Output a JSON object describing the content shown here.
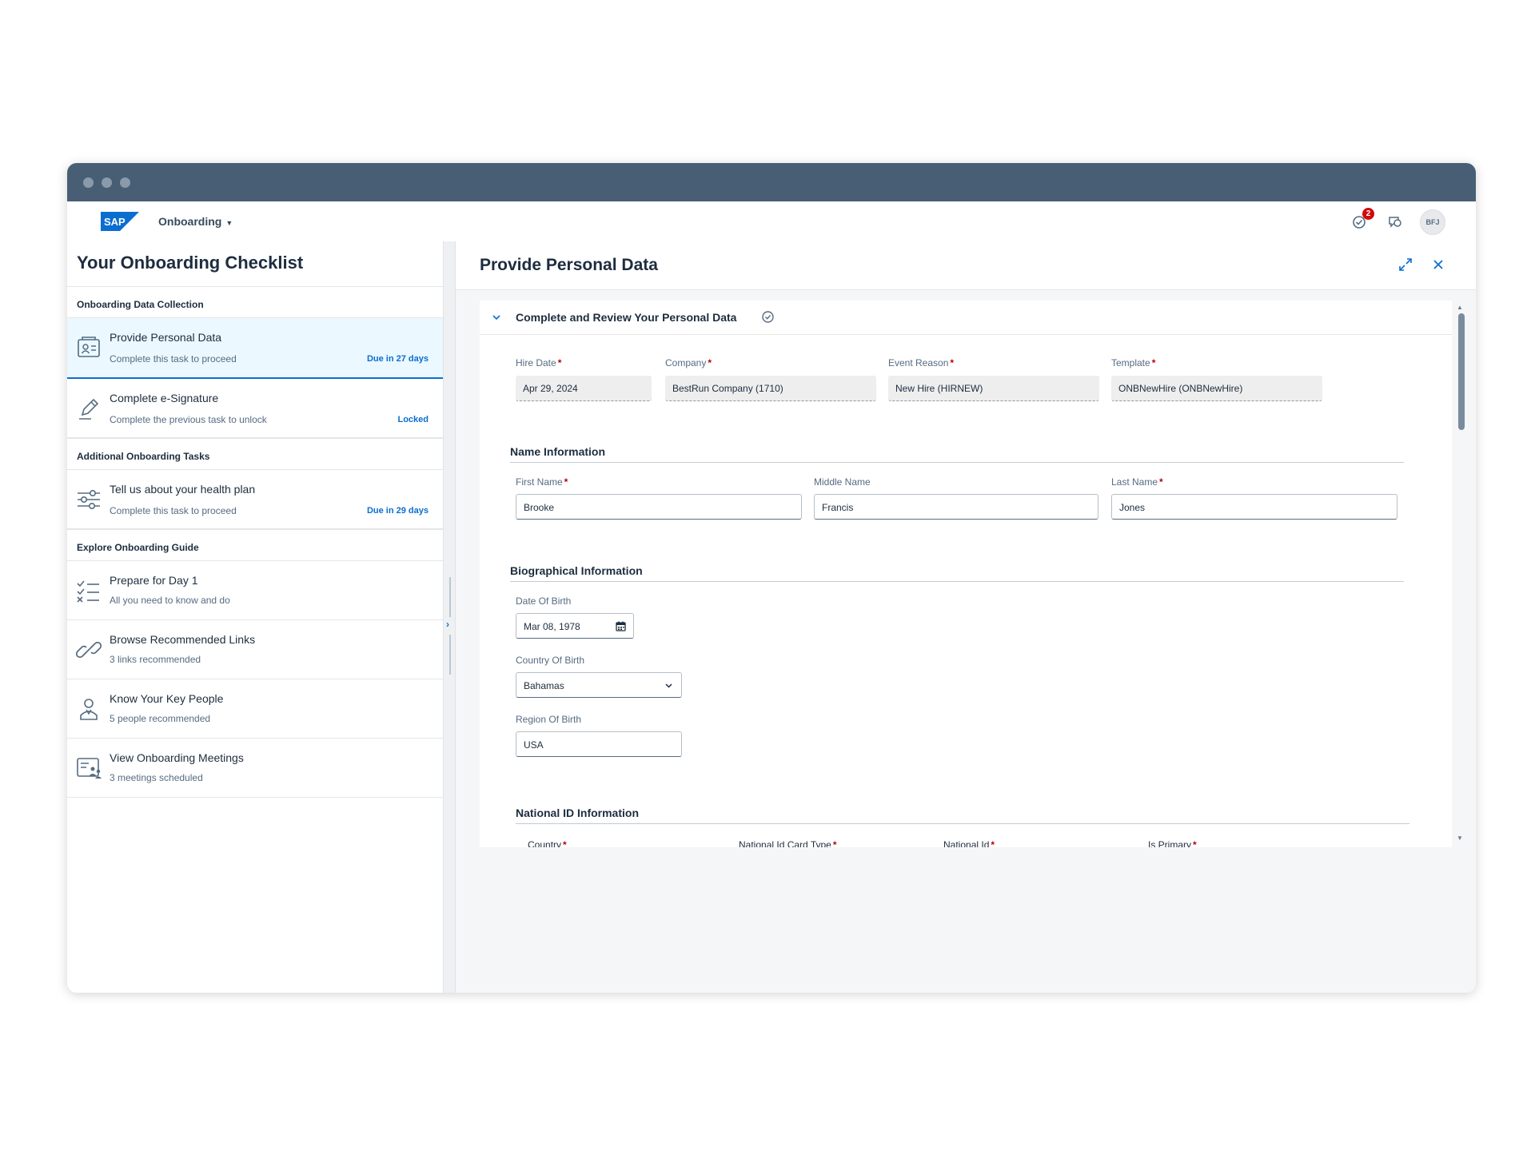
{
  "shellbar": {
    "app_title": "Onboarding",
    "notification_count": "2",
    "avatar_initials": "BFJ",
    "colors": {
      "brand": "#0a6ed1",
      "titlebar": "#475e75",
      "badge": "#d20a0a"
    }
  },
  "checklist": {
    "title": "Your Onboarding Checklist",
    "groups": [
      {
        "header": "Onboarding Data Collection",
        "items": [
          {
            "icon": "id-card-icon",
            "title": "Provide Personal Data",
            "subtitle": "Complete this task to proceed",
            "status": "Due in 27 days"
          },
          {
            "icon": "pen-icon",
            "title": "Complete e-Signature",
            "subtitle": "Complete the previous task to unlock",
            "status": "Locked"
          }
        ]
      },
      {
        "header": "Additional Onboarding Tasks",
        "items": [
          {
            "icon": "sliders-icon",
            "title": "Tell us about your health plan",
            "subtitle": "Complete this task to proceed",
            "status": "Due in 29 days"
          }
        ]
      },
      {
        "header": "Explore Onboarding Guide",
        "items": [
          {
            "icon": "checklist-icon",
            "title": "Prepare for Day 1",
            "subtitle": "All you need to know and do"
          },
          {
            "icon": "link-icon",
            "title": "Browse Recommended Links",
            "subtitle": "3 links recommended"
          },
          {
            "icon": "person-icon",
            "title": "Know Your Key People",
            "subtitle": "5 people recommended"
          },
          {
            "icon": "meeting-icon",
            "title": "View Onboarding Meetings",
            "subtitle": "3 meetings scheduled"
          }
        ]
      }
    ]
  },
  "detail": {
    "title": "Provide Personal Data",
    "section_title": "Complete and Review Your Personal Data",
    "job_info": {
      "hire_date": {
        "label": "Hire Date",
        "value": "Apr 29, 2024"
      },
      "company": {
        "label": "Company",
        "value": "BestRun Company (1710)"
      },
      "event_reason": {
        "label": "Event Reason",
        "value": "New Hire (HIRNEW)"
      },
      "template": {
        "label": "Template",
        "value": "ONBNewHire (ONBNewHire)"
      }
    },
    "name_info": {
      "title": "Name Information",
      "first_name": {
        "label": "First Name",
        "value": "Brooke"
      },
      "middle_name": {
        "label": "Middle Name",
        "value": "Francis"
      },
      "last_name": {
        "label": "Last Name",
        "value": "Jones"
      }
    },
    "bio_info": {
      "title": "Biographical Information",
      "dob": {
        "label": "Date Of Birth",
        "value": "Mar 08, 1978"
      },
      "country": {
        "label": "Country Of Birth",
        "value": "Bahamas"
      },
      "region": {
        "label": "Region Of Birth",
        "value": "USA"
      }
    },
    "national_id": {
      "title": "National ID Information",
      "columns": [
        "Country",
        "National Id Card Type",
        "National Id",
        "Is Primary"
      ]
    },
    "required_mark": "*"
  }
}
